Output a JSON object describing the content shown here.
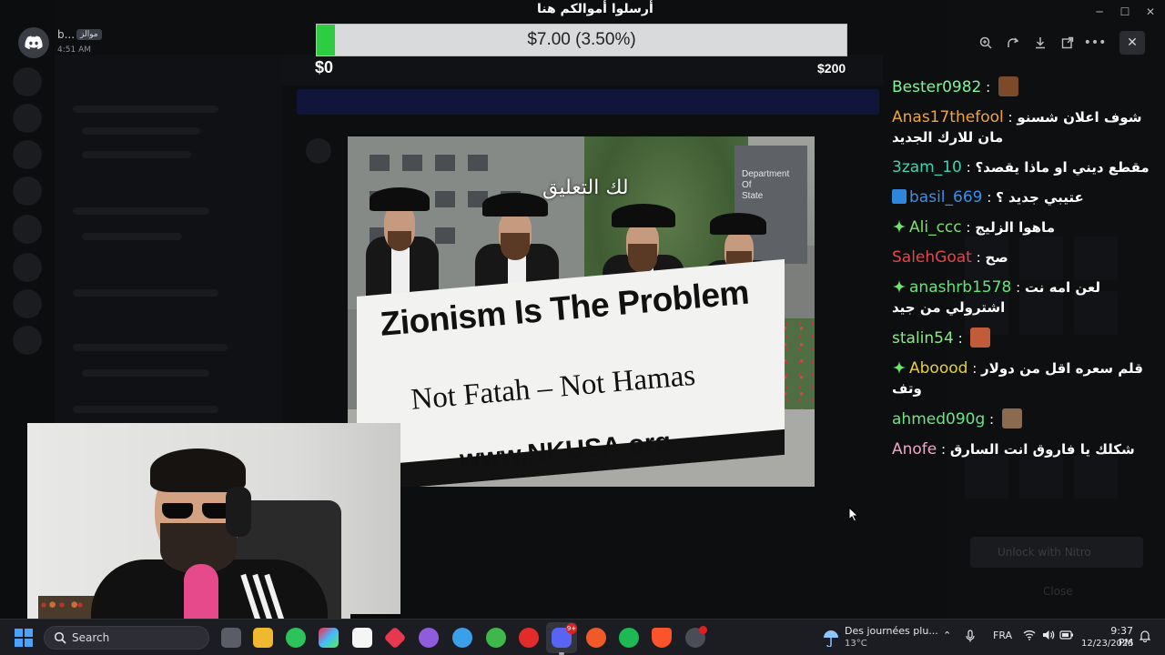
{
  "notification": {
    "name": "b...",
    "tag": "موالز",
    "time": "4:51 AM"
  },
  "goal": {
    "title": "أرسلوا أموالكم هنا",
    "amount_text": "$7.00 (3.50%)",
    "progress_percent": 3.5,
    "min_label": "$0",
    "max_label": "$200",
    "fill_color": "#2ecc40"
  },
  "viewer": {
    "tools": [
      "zoom-icon",
      "rotate-icon",
      "download-icon",
      "open-external-icon",
      "more-icon"
    ],
    "close_icon": "close-icon"
  },
  "photo": {
    "caption": "لك التعليق",
    "banner_line1": "Zionism Is The Problem",
    "banner_line2": "Not Fatah – Not Hamas",
    "banner_line3": "www.NKUSA.org",
    "sign_text": "Department\nOf\nState"
  },
  "chat": [
    {
      "user": "Bester0982",
      "color": "#7ff59a",
      "text": "",
      "badge": "",
      "emote": true
    },
    {
      "user": "Anas17thefool",
      "color": "#f2a33a",
      "text": "شوف اعلان شسنو مان للارك الجديد",
      "badge": "",
      "emote": false
    },
    {
      "user": "3zam_10",
      "color": "#3fd4b0",
      "text": "مقطع ديني او ماذا يقصد؟",
      "badge": "",
      "emote": false
    },
    {
      "user": "basil_669",
      "color": "#3b8fe8",
      "text": "عتيبي جديد ؟",
      "badge": "arrow-badge",
      "emote": false
    },
    {
      "user": "Ali_ccc",
      "color": "#7be06a",
      "text": "ماهوا الزليج",
      "badge": "diamond-badge",
      "emote": false
    },
    {
      "user": "SalehGoat",
      "color": "#e0474c",
      "text": "صح",
      "badge": "",
      "emote": false
    },
    {
      "user": "anashrb1578",
      "color": "#62e57b",
      "text": "لعن امه نت اشترولي من جيد",
      "badge": "diamond-badge",
      "emote": false
    },
    {
      "user": "stalin54",
      "color": "#8ee88a",
      "text": "",
      "badge": "",
      "emote": true
    },
    {
      "user": "Aboood",
      "color": "#e6d13c",
      "text": "قلم سعره اقل من دولار وتف",
      "badge": "diamond-badge",
      "emote": false
    },
    {
      "user": "ahmed090g",
      "color": "#6fe28a",
      "text": "",
      "badge": "",
      "emote": true
    },
    {
      "user": "Anofe",
      "color": "#f0a6c8",
      "text": "شكلك يا فاروق انت السارق",
      "badge": "",
      "emote": false
    }
  ],
  "background": {
    "nitro_button": "Unlock with Nitro",
    "close_label": "Close"
  },
  "taskbar": {
    "search_placeholder": "Search",
    "weather_line1": "Des journées plu...",
    "weather_line2": "13°C",
    "language": "FRA",
    "time": "9:37 PM",
    "date": "12/23/2025",
    "discord_badge": "9+"
  }
}
